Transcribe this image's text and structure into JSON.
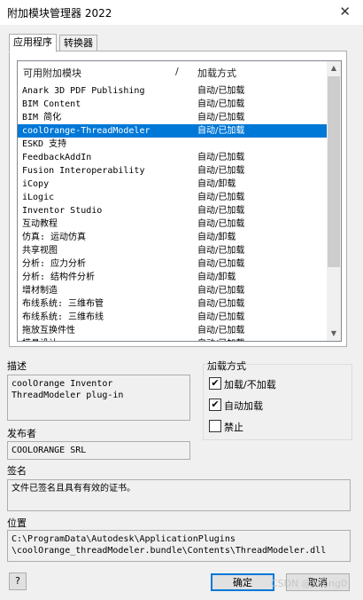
{
  "window": {
    "title": "附加模块管理器 2022",
    "close_label": "✕"
  },
  "tabs": [
    {
      "label": "应用程序"
    },
    {
      "label": "转换器"
    }
  ],
  "list": {
    "headers": {
      "name": "可用附加模块",
      "sort_glyph": "/",
      "load": "加载方式"
    },
    "rows": [
      {
        "name": "Anark 3D PDF Publishing",
        "load": "自动/已加载"
      },
      {
        "name": "BIM Content",
        "load": "自动/已加载"
      },
      {
        "name": "BIM 简化",
        "load": "自动/已加载"
      },
      {
        "name": "coolOrange-ThreadModeler",
        "load": "自动/已加载"
      },
      {
        "name": "ESKD 支持",
        "load": ""
      },
      {
        "name": "FeedbackAddIn",
        "load": "自动/已加载"
      },
      {
        "name": "Fusion Interoperability",
        "load": "自动/已加载"
      },
      {
        "name": "iCopy",
        "load": "自动/卸载"
      },
      {
        "name": "iLogic",
        "load": "自动/已加载"
      },
      {
        "name": "Inventor Studio",
        "load": "自动/已加载"
      },
      {
        "name": "互动教程",
        "load": "自动/已加载"
      },
      {
        "name": "仿真: 运动仿真",
        "load": "自动/卸载"
      },
      {
        "name": "共享视图",
        "load": "自动/已加载"
      },
      {
        "name": "分析: 应力分析",
        "load": "自动/已加载"
      },
      {
        "name": "分析: 结构件分析",
        "load": "自动/卸载"
      },
      {
        "name": "增材制造",
        "load": "自动/已加载"
      },
      {
        "name": "布线系统: 三维布管",
        "load": "自动/已加载"
      },
      {
        "name": "布线系统: 三维布线",
        "load": "自动/已加载"
      },
      {
        "name": "拖放互换件性",
        "load": "自动/已加载"
      },
      {
        "name": "模具设计",
        "load": "自动/已加载"
      }
    ],
    "selected_index": 3,
    "scroll_up": "▲",
    "scroll_down": "▼"
  },
  "description": {
    "label": "描述",
    "text": "coolOrange Inventor\nThreadModeler plug-in"
  },
  "publisher": {
    "label": "发布者",
    "text": "COOLORANGE SRL"
  },
  "signature": {
    "label": "签名",
    "text": "文件已签名且具有有效的证书。"
  },
  "location": {
    "label": "位置",
    "text": "C:\\ProgramData\\Autodesk\\ApplicationPlugins\n\\coolOrange_threadModeler.bundle\\Contents\\ThreadModeler.dll"
  },
  "load_behavior": {
    "label": "加载方式",
    "options": [
      {
        "label": "加载/不加载",
        "checked": true
      },
      {
        "label": "自动加载",
        "checked": true
      },
      {
        "label": "禁止",
        "checked": false
      }
    ]
  },
  "buttons": {
    "ok": "确定",
    "cancel": "取消",
    "help": "?"
  },
  "watermark": "CSDN @xilong0"
}
